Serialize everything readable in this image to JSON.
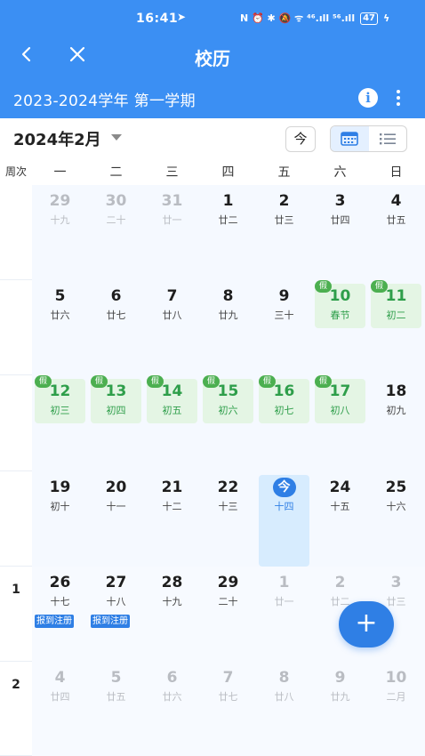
{
  "status_bar": {
    "time": "16:41",
    "icons_text": "N ⏰ ✱ 🔕 ᯤ ⁴⁶.ıll ⁵⁶.ıll",
    "battery": "47"
  },
  "nav": {
    "title": "校历"
  },
  "term_bar": {
    "term": "2023-2024学年 第一学期",
    "info_icon": "i"
  },
  "toolbar": {
    "month": "2024年2月",
    "today_label": "今"
  },
  "week_header": {
    "week_col": "周次",
    "days": [
      "一",
      "二",
      "三",
      "四",
      "五",
      "六",
      "日"
    ]
  },
  "holiday_badge": "假",
  "weeks": [
    {
      "num": "",
      "days": [
        {
          "d": "29",
          "l": "十九",
          "muted": true
        },
        {
          "d": "30",
          "l": "二十",
          "muted": true
        },
        {
          "d": "31",
          "l": "廿一",
          "muted": true
        },
        {
          "d": "1",
          "l": "廿二"
        },
        {
          "d": "2",
          "l": "廿三"
        },
        {
          "d": "3",
          "l": "廿四"
        },
        {
          "d": "4",
          "l": "廿五"
        }
      ]
    },
    {
      "num": "",
      "days": [
        {
          "d": "5",
          "l": "廿六"
        },
        {
          "d": "6",
          "l": "廿七"
        },
        {
          "d": "7",
          "l": "廿八"
        },
        {
          "d": "8",
          "l": "廿九"
        },
        {
          "d": "9",
          "l": "三十"
        },
        {
          "d": "10",
          "l": "春节",
          "holiday": true
        },
        {
          "d": "11",
          "l": "初二",
          "holiday": true
        }
      ]
    },
    {
      "num": "",
      "days": [
        {
          "d": "12",
          "l": "初三",
          "holiday": true
        },
        {
          "d": "13",
          "l": "初四",
          "holiday": true
        },
        {
          "d": "14",
          "l": "初五",
          "holiday": true
        },
        {
          "d": "15",
          "l": "初六",
          "holiday": true
        },
        {
          "d": "16",
          "l": "初七",
          "holiday": true
        },
        {
          "d": "17",
          "l": "初八",
          "holiday": true
        },
        {
          "d": "18",
          "l": "初九"
        }
      ]
    },
    {
      "num": "",
      "days": [
        {
          "d": "19",
          "l": "初十"
        },
        {
          "d": "20",
          "l": "十一"
        },
        {
          "d": "21",
          "l": "十二"
        },
        {
          "d": "22",
          "l": "十三"
        },
        {
          "d": "今",
          "l": "十四",
          "today": true
        },
        {
          "d": "24",
          "l": "十五"
        },
        {
          "d": "25",
          "l": "十六"
        }
      ]
    },
    {
      "num": "1",
      "days": [
        {
          "d": "26",
          "l": "十七",
          "event": "报到注册"
        },
        {
          "d": "27",
          "l": "十八",
          "event": "报到注册"
        },
        {
          "d": "28",
          "l": "十九"
        },
        {
          "d": "29",
          "l": "二十"
        },
        {
          "d": "1",
          "l": "廿一",
          "muted": true
        },
        {
          "d": "2",
          "l": "廿二",
          "muted": true
        },
        {
          "d": "3",
          "l": "廿三",
          "muted": true
        }
      ]
    },
    {
      "num": "2",
      "days": [
        {
          "d": "4",
          "l": "廿四",
          "muted": true
        },
        {
          "d": "5",
          "l": "廿五",
          "muted": true
        },
        {
          "d": "6",
          "l": "廿六",
          "muted": true
        },
        {
          "d": "7",
          "l": "廿七",
          "muted": true
        },
        {
          "d": "8",
          "l": "廿八",
          "muted": true
        },
        {
          "d": "9",
          "l": "廿九",
          "muted": true
        },
        {
          "d": "10",
          "l": "二月",
          "muted": true
        }
      ]
    }
  ],
  "fab": {
    "label": "+"
  },
  "colors": {
    "header": "#3b8ff3",
    "accent": "#2f7fe5",
    "holiday": "#2e9e4a",
    "holiday_bg": "#e4f5e4"
  }
}
